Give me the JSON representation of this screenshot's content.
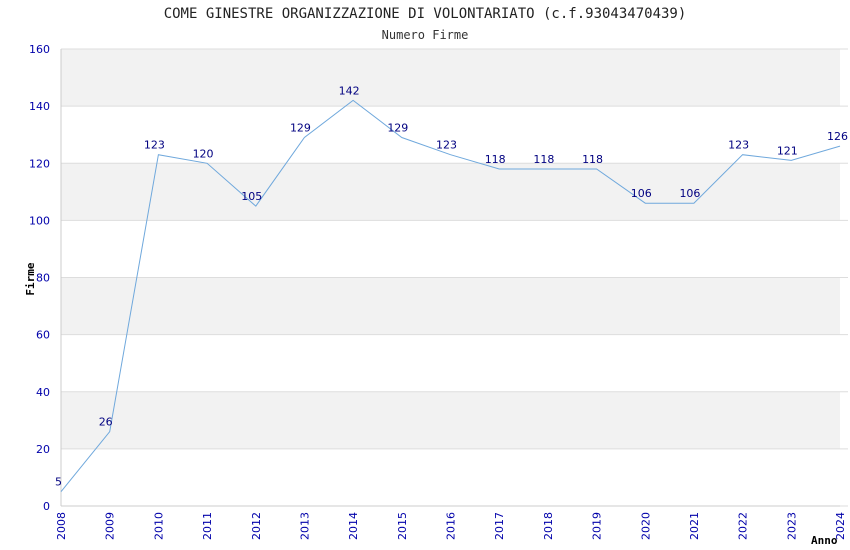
{
  "chart_data": {
    "type": "line",
    "title": "COME GINESTRE ORGANIZZAZIONE DI VOLONTARIATO (c.f.93043470439)",
    "subtitle": "Numero Firme",
    "xlabel": "Anno",
    "ylabel": "Firme",
    "ylim": [
      0,
      160
    ],
    "yticks": [
      0,
      20,
      40,
      60,
      80,
      100,
      120,
      140,
      160
    ],
    "grid": true,
    "line_color": "#6fa8dc",
    "x": [
      "2008",
      "2009",
      "2010",
      "2011",
      "2012",
      "2013",
      "2014",
      "2015",
      "2016",
      "2017",
      "2018",
      "2019",
      "2020",
      "2021",
      "2022",
      "2023",
      "2024"
    ],
    "series": [
      {
        "values": [
          5,
          26,
          123,
          120,
          105,
          129,
          142,
          129,
          123,
          118,
          118,
          118,
          106,
          106,
          123,
          121,
          126
        ]
      }
    ]
  }
}
